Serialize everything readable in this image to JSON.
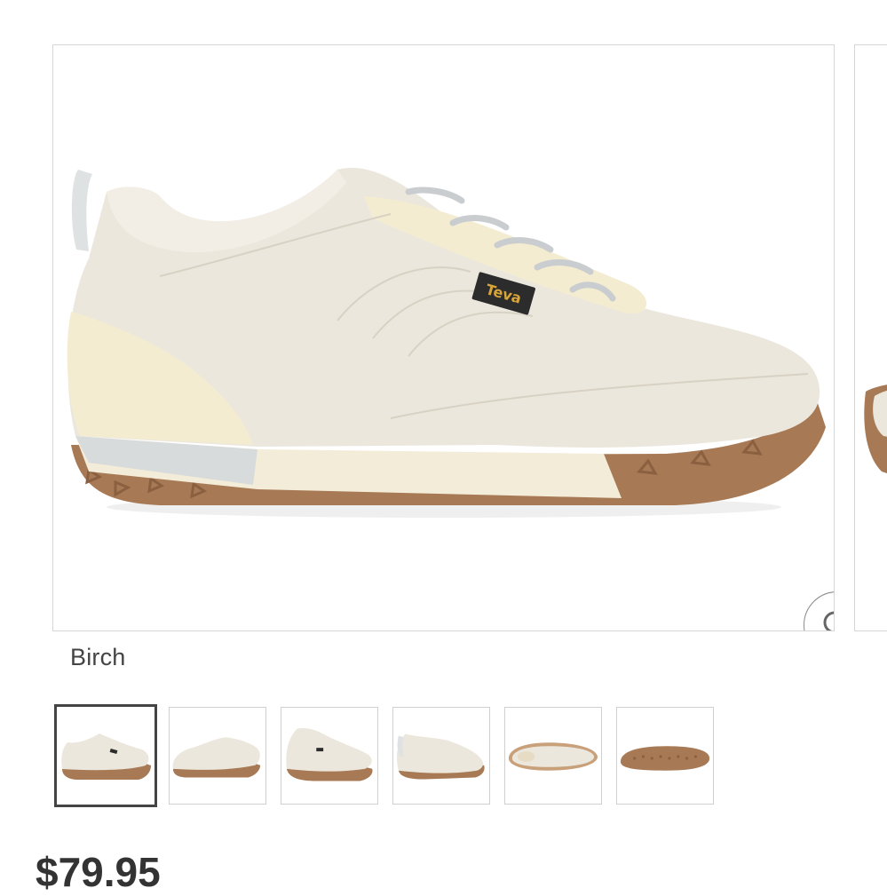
{
  "product": {
    "color_name": "Birch",
    "price": "$79.95",
    "logo_text": "Teva"
  },
  "gallery": {
    "selected_index": 0,
    "thumbnails": [
      {
        "view": "side-view"
      },
      {
        "view": "side-view-medial"
      },
      {
        "view": "three-quarter-front"
      },
      {
        "view": "three-quarter-back"
      },
      {
        "view": "top-view"
      },
      {
        "view": "outsole"
      }
    ]
  },
  "icons": {
    "zoom": "magnifier-icon"
  },
  "colors": {
    "upper": "#ece7dc",
    "sole": "#a77a55",
    "border": "#d6d6d6"
  }
}
